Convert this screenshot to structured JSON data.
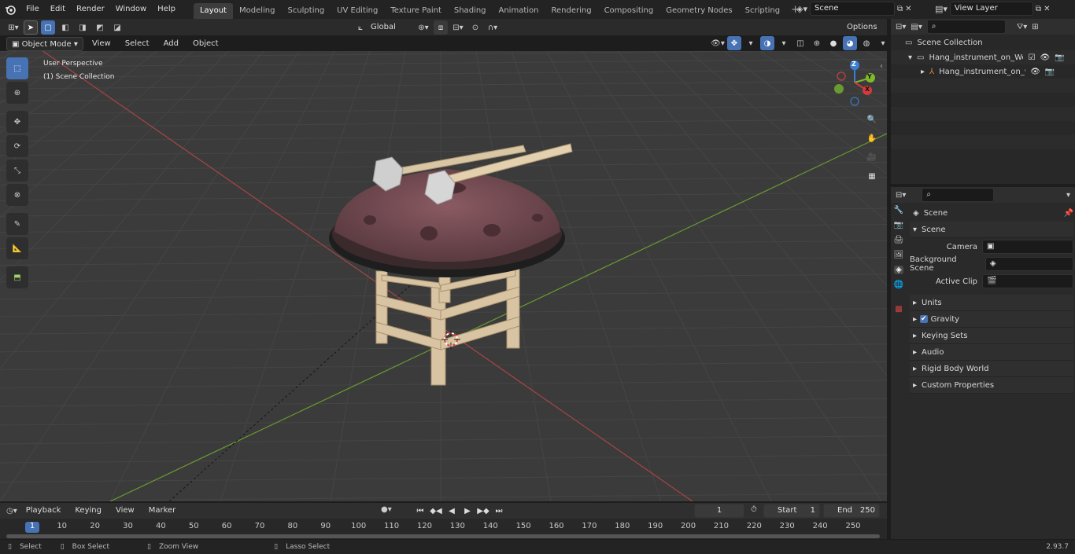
{
  "topbar": {
    "menus": [
      "File",
      "Edit",
      "Render",
      "Window",
      "Help"
    ],
    "workspaces": [
      "Layout",
      "Modeling",
      "Sculpting",
      "UV Editing",
      "Texture Paint",
      "Shading",
      "Animation",
      "Rendering",
      "Compositing",
      "Geometry Nodes",
      "Scripting"
    ],
    "active_workspace": "Layout",
    "scene_name": "Scene",
    "view_layer": "View Layer"
  },
  "viewport": {
    "mode": "Object Mode",
    "menus": [
      "View",
      "Select",
      "Add",
      "Object"
    ],
    "transform_orientation": "Global",
    "options_label": "Options",
    "overlay_title": "User Perspective",
    "overlay_subtitle": "(1) Scene Collection",
    "gizmo_axes": {
      "z": "Z",
      "y": "Y",
      "x": "X"
    }
  },
  "outliner": {
    "root": "Scene Collection",
    "items": [
      {
        "label": "Hang_instrument_on_Wooden"
      },
      {
        "label": "Hang_instrument_on_wo"
      }
    ]
  },
  "properties": {
    "context": "Scene",
    "section": "Scene",
    "fields": [
      {
        "label": "Camera"
      },
      {
        "label": "Background Scene"
      },
      {
        "label": "Active Clip"
      }
    ],
    "panels": [
      "Units",
      "Gravity",
      "Keying Sets",
      "Audio",
      "Rigid Body World",
      "Custom Properties"
    ]
  },
  "timeline": {
    "menus": [
      "Playback",
      "Keying",
      "View",
      "Marker"
    ],
    "current_frame": "1",
    "start_label": "Start",
    "start_value": "1",
    "end_label": "End",
    "end_value": "250",
    "ticks": [
      "1",
      "10",
      "20",
      "30",
      "40",
      "50",
      "60",
      "70",
      "80",
      "90",
      "100",
      "110",
      "120",
      "130",
      "140",
      "150",
      "160",
      "170",
      "180",
      "190",
      "200",
      "210",
      "220",
      "230",
      "240",
      "250"
    ]
  },
  "status": {
    "select": "Select",
    "box_select": "Box Select",
    "zoom_view": "Zoom View",
    "lasso_select": "Lasso Select",
    "version": "2.93.7"
  },
  "colors": {
    "accent": "#4772b3",
    "x_axis": "#d33a3a",
    "y_axis": "#7fb82a",
    "z_axis": "#3a7fd3"
  }
}
